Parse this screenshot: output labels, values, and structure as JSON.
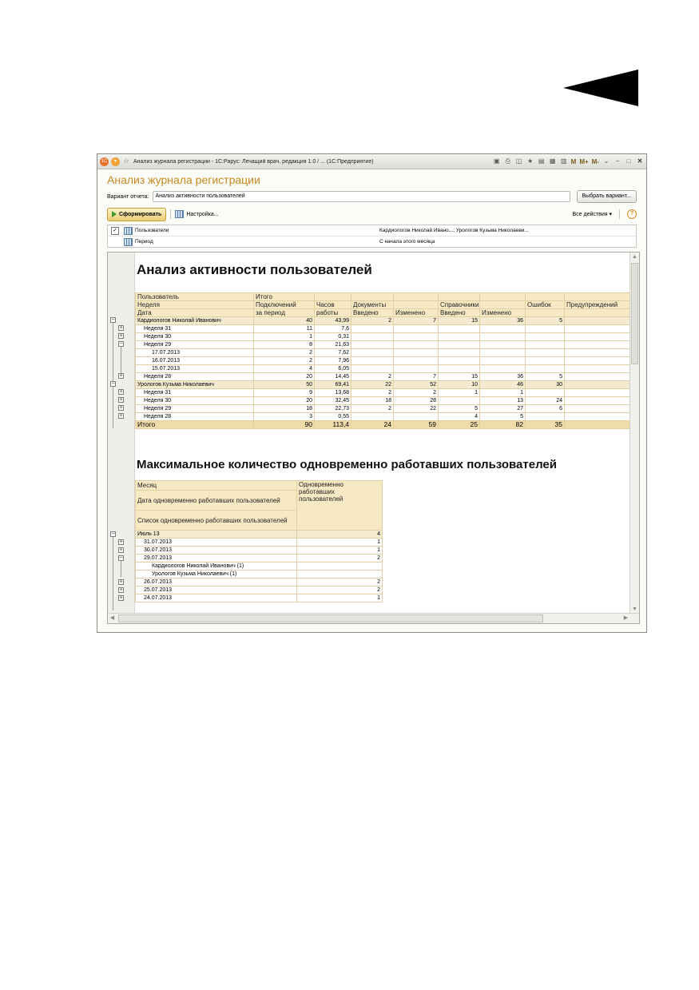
{
  "window": {
    "title": "Анализ журнала регистрации - 1С:Рарус: Лечащий врач, редакция 1.0 / ...  (1С:Предприятие)",
    "memory_buttons": [
      "M",
      "M+",
      "M-"
    ]
  },
  "form": {
    "title": "Анализ журнала регистрации",
    "variant_label": "Вариант отчета:",
    "variant_value": "Анализ активности пользователей",
    "choose_variant_button": "Выбрать вариант..."
  },
  "toolbar": {
    "generate_button": "Сформировать",
    "settings_button": "Настройка...",
    "all_actions": "Все действия ▾",
    "help": "?"
  },
  "settings": [
    {
      "checked": true,
      "name": "Пользователи",
      "value": "Кардиологов Николай Ивано...; Урологов Кузьма Николаеви..."
    },
    {
      "checked": false,
      "name": "Период",
      "value": "С начала этого месяца"
    }
  ],
  "report1": {
    "title": "Анализ активности пользователей",
    "header": [
      [
        "Пользователь",
        "Итого",
        "",
        "",
        "",
        "",
        "",
        "",
        ""
      ],
      [
        "Неделя",
        "Подключений",
        "Часов",
        "Документы",
        "",
        "Справочники",
        "",
        "Ошибок",
        "Предупреждений"
      ],
      [
        "Дата",
        "за период",
        "работы",
        "Введено",
        "Изменено",
        "Введено",
        "Изменено",
        "",
        ""
      ]
    ],
    "rows": [
      [
        "Кардиологов Николай Иванович",
        "40",
        "43,99",
        "2",
        "7",
        "15",
        "36",
        "5",
        ""
      ],
      [
        "Неделя 31",
        "11",
        "7,6",
        "",
        "",
        "",
        "",
        "",
        ""
      ],
      [
        "Неделя 30",
        "1",
        "0,31",
        "",
        "",
        "",
        "",
        "",
        ""
      ],
      [
        "Неделя 29",
        "8",
        "21,63",
        "",
        "",
        "",
        "",
        "",
        ""
      ],
      [
        "17.07.2013",
        "2",
        "7,62",
        "",
        "",
        "",
        "",
        "",
        ""
      ],
      [
        "16.07.2013",
        "2",
        "7,96",
        "",
        "",
        "",
        "",
        "",
        ""
      ],
      [
        "15.07.2013",
        "4",
        "6,05",
        "",
        "",
        "",
        "",
        "",
        ""
      ],
      [
        "Неделя 28",
        "20",
        "14,45",
        "2",
        "7",
        "15",
        "36",
        "5",
        ""
      ],
      [
        "Урологов Кузьма Николаевич",
        "50",
        "69,41",
        "22",
        "52",
        "10",
        "46",
        "30",
        ""
      ],
      [
        "Неделя 31",
        "9",
        "13,68",
        "2",
        "2",
        "1",
        "1",
        "",
        ""
      ],
      [
        "Неделя 30",
        "20",
        "32,45",
        "18",
        "28",
        "",
        "13",
        "24",
        ""
      ],
      [
        "Неделя 29",
        "18",
        "22,73",
        "2",
        "22",
        "5",
        "27",
        "6",
        ""
      ],
      [
        "Неделя 28",
        "3",
        "0,55",
        "",
        "",
        "4",
        "5",
        "",
        ""
      ]
    ],
    "total": [
      "Итого",
      "90",
      "113,4",
      "24",
      "59",
      "25",
      "82",
      "35",
      ""
    ]
  },
  "report2": {
    "title": "Максимальное количество одновременно работавших пользователей",
    "header_left": [
      "Месяц",
      "Дата одновременно работавших пользователей",
      "Список одновременно работавших пользователей"
    ],
    "header_right": "Одновременно работавших пользователей",
    "rows": [
      [
        "Июль 13",
        "4"
      ],
      [
        "31.07.2013",
        "1"
      ],
      [
        "30.07.2013",
        "1"
      ],
      [
        "29.07.2013",
        "2"
      ],
      [
        "Кардиологов Николай Иванович (1)",
        ""
      ],
      [
        "Урологов Кузьма Николаевич (1)",
        ""
      ],
      [
        "26.07.2013",
        "2"
      ],
      [
        "25.07.2013",
        "2"
      ],
      [
        "24.07.2013",
        "1"
      ]
    ]
  }
}
